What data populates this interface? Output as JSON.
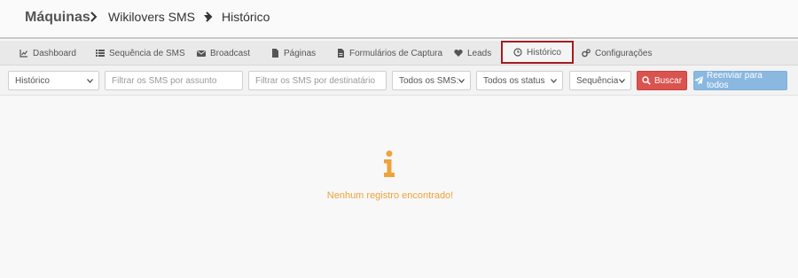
{
  "breadcrumb": {
    "root": "Máquinas",
    "machine": "Wikilovers SMS",
    "current": "Histórico"
  },
  "tabs": [
    {
      "label": "Dashboard",
      "icon": "chart-line-icon"
    },
    {
      "label": "Sequência de SMS",
      "icon": "list-icon"
    },
    {
      "label": "Broadcast",
      "icon": "envelope-icon"
    },
    {
      "label": "Páginas",
      "icon": "file-icon"
    },
    {
      "label": "Formulários de Captura",
      "icon": "file-text-icon"
    },
    {
      "label": "Leads",
      "icon": "heart-icon"
    },
    {
      "label": "Histórico",
      "icon": "clock-icon",
      "active": true
    },
    {
      "label": "Configurações",
      "icon": "gears-icon"
    }
  ],
  "filters": {
    "type_select": "Histórico",
    "subject_placeholder": "Filtrar os SMS por assunto",
    "recipient_placeholder": "Filtrar os SMS por destinatário",
    "sms_select": "Todos os SMS:",
    "status_select": "Todos os status",
    "sequence_select": "Sequência",
    "search_label": "Buscar",
    "resend_label": "Reenviar para todos"
  },
  "empty_state": {
    "icon": "info-icon",
    "message": "Nenhum registro encontrado!"
  },
  "colors": {
    "active_tab_border": "#a11d22",
    "search_button": "#d9534f",
    "resend_button": "#8ab8e0",
    "empty_state": "#efa23c"
  }
}
